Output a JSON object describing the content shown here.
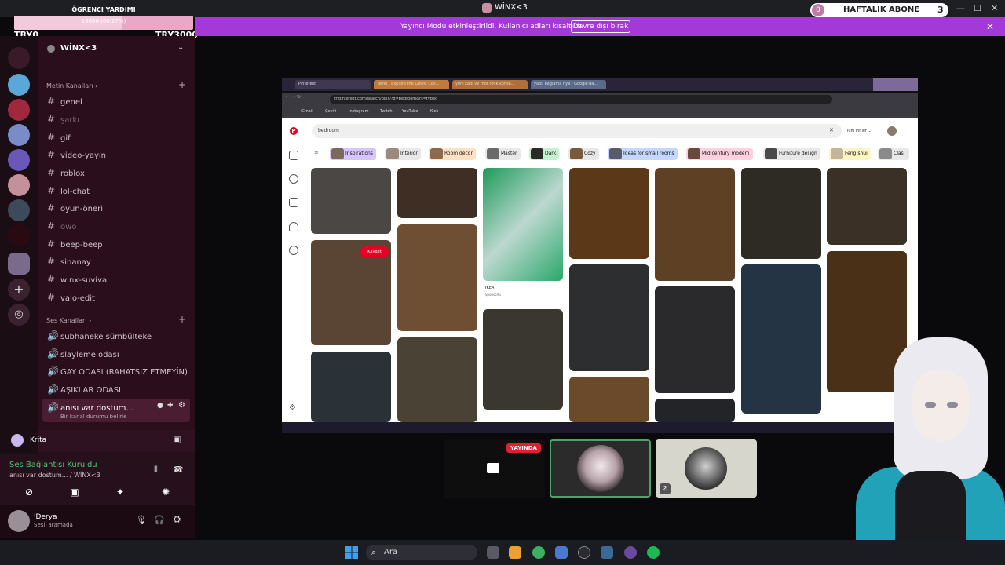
{
  "goal": {
    "title": "ÖGRENCI YARDIMI",
    "progress_text": "18086 (60.27%)",
    "progress_fraction": 0.6027,
    "min_label": "TRY0",
    "max_label": "TRY3000"
  },
  "window": {
    "title": "WİNX<3"
  },
  "subs": {
    "count": "0",
    "label": "HAFTALIK ABONE",
    "goal": "3"
  },
  "banner": {
    "text": "Yayıncı Modu etkinleştirildi. Kullanıcı adları kısaltıldı.",
    "button": "Devre dışı bırak",
    "close": "✕"
  },
  "server": {
    "name": "WİNX<3",
    "chevron": "⌄"
  },
  "text_category": "Metin Kanalları",
  "text_channels": [
    "genel",
    "şarkı",
    "gif",
    "video-yayın",
    "roblox",
    "lol-chat",
    "oyun-öneri",
    "owo",
    "beep-beep",
    "sinanay",
    "winx-suvival",
    "valo-edit"
  ],
  "voice_category": "Ses Kanalları",
  "voice_channels": [
    "subhaneke sümbülteke",
    "slayleme odası",
    "GAY ODASI (RAHATSIZ ETMEYİN)",
    "AŞIKLAR ODASI",
    "anısı var dostum..."
  ],
  "active_channel_status": "Bir kanal durumu belirle",
  "voice_user": "Krita",
  "voice_panel": {
    "status": "Ses Bağlantısı Kuruldu",
    "where": "anısı var dostum... / WİNX<3"
  },
  "me": {
    "name": "'Derya",
    "status": "Sesli aramada"
  },
  "browser": {
    "url": "tr.pinterest.com/search/pins/?q=bedroom&rs=typed",
    "tabs": [
      "Pinterest",
      "Temu | Explore the Latest Coll...",
      "yeni kadı ve mor renk konse...",
      "yapıl bağlama nya - Google'da..."
    ],
    "bookmarks": [
      "Gmail",
      "Çeviri",
      "Instagram",
      "Twitch",
      "YouTube",
      "Kick"
    ]
  },
  "pinterest": {
    "search": "bedroom",
    "filter": "Tüm Pinler ⌄",
    "chips": [
      "Inspirations",
      "Interior",
      "Room decor",
      "Master",
      "Dark",
      "Cozy",
      "Ideas for small rooms",
      "Mid century modern",
      "Furniture design",
      "Feng shui",
      "Clas"
    ],
    "save": "Kaydet",
    "ad_label": "IKEA",
    "ad_sub": "Sponsorlu"
  },
  "stream_tiles": {
    "live_badge": "YAYINDA"
  },
  "taskbar": {
    "search": "Ara"
  },
  "colors": {
    "banner": "#a439d8",
    "sidebar": "#2a0e1c",
    "accent_pink": "#e9a8c7",
    "live_red": "#e02030",
    "connected_green": "#4ec77a"
  }
}
